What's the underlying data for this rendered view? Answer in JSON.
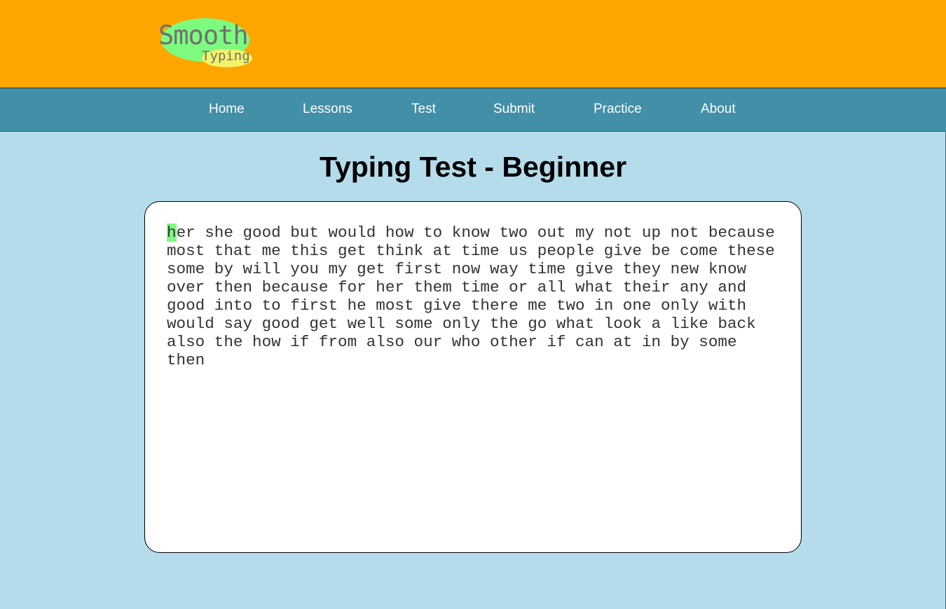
{
  "logo": {
    "word1": "Smooth",
    "word2": "Typing"
  },
  "nav": {
    "items": [
      {
        "label": "Home"
      },
      {
        "label": "Lessons"
      },
      {
        "label": "Test"
      },
      {
        "label": "Submit"
      },
      {
        "label": "Practice"
      },
      {
        "label": "About"
      }
    ]
  },
  "page": {
    "title": "Typing Test - Beginner"
  },
  "typing": {
    "current_char": "h",
    "lines": [
      "er she good but would how to know two out my not up not because",
      "most that me this get think at time us people give be come these",
      "some by will you my get first now way time give they new know",
      "over then because for her them time or all what their any and",
      "good into to first he most give there me two in one only with",
      "would say good get well some only the go what look a like back",
      "also the how if from also our who other if can at in by some",
      "then"
    ]
  },
  "colors": {
    "header": "#ffa600",
    "nav": "#428fa8",
    "background": "#b5dcea",
    "cursor_highlight": "#7dfb7f"
  }
}
